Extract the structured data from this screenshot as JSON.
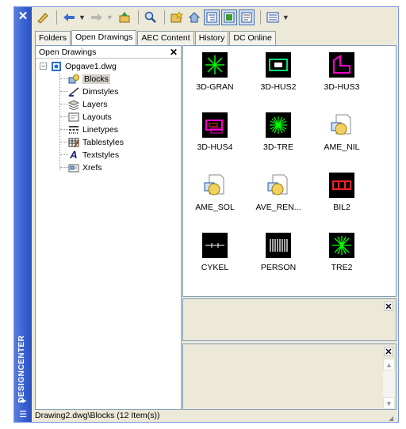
{
  "window": {
    "title": "DESIGNCENTER"
  },
  "toolbar": {
    "buttons": [
      {
        "icon": "load-icon"
      },
      {
        "icon": "back-icon"
      },
      {
        "icon": "forward-icon"
      },
      {
        "icon": "up-icon"
      },
      {
        "icon": "search-icon"
      },
      {
        "icon": "favorites-icon"
      },
      {
        "icon": "home-icon"
      },
      {
        "icon": "tree-toggle-icon"
      },
      {
        "icon": "preview-icon"
      },
      {
        "icon": "description-icon"
      },
      {
        "icon": "views-icon"
      }
    ]
  },
  "tabs": [
    {
      "label": "Folders"
    },
    {
      "label": "Open Drawings"
    },
    {
      "label": "AEC Content"
    },
    {
      "label": "History"
    },
    {
      "label": "DC Online"
    }
  ],
  "tree": {
    "header": "Open Drawings",
    "root": "Opgave1.dwg",
    "items": [
      {
        "label": "Blocks",
        "icon": "blocks-icon"
      },
      {
        "label": "Dimstyles",
        "icon": "dimstyles-icon"
      },
      {
        "label": "Layers",
        "icon": "layers-icon"
      },
      {
        "label": "Layouts",
        "icon": "layouts-icon"
      },
      {
        "label": "Linetypes",
        "icon": "linetypes-icon"
      },
      {
        "label": "Tablestyles",
        "icon": "tablestyles-icon"
      },
      {
        "label": "Textstyles",
        "icon": "textstyles-icon"
      },
      {
        "label": "Xrefs",
        "icon": "xrefs-icon"
      }
    ]
  },
  "content": {
    "items": [
      {
        "label": "3D-GRAN",
        "kind": "star-green"
      },
      {
        "label": "3D-HUS2",
        "kind": "house-green"
      },
      {
        "label": "3D-HUS3",
        "kind": "house-magenta"
      },
      {
        "label": "3D-HUS4",
        "kind": "box-magenta"
      },
      {
        "label": "3D-TRE",
        "kind": "tree-green"
      },
      {
        "label": "AME_NIL",
        "kind": "doc-icon"
      },
      {
        "label": "AME_SOL",
        "kind": "doc-icon"
      },
      {
        "label": "AVE_REN...",
        "kind": "doc-icon"
      },
      {
        "label": "BIL2",
        "kind": "car-red"
      },
      {
        "label": "CYKEL",
        "kind": "bike-white"
      },
      {
        "label": "PERSON",
        "kind": "barcode-white"
      },
      {
        "label": "TRE2",
        "kind": "star-green"
      }
    ]
  },
  "status": {
    "text": "Drawing2.dwg\\Blocks (12 Item(s))"
  }
}
